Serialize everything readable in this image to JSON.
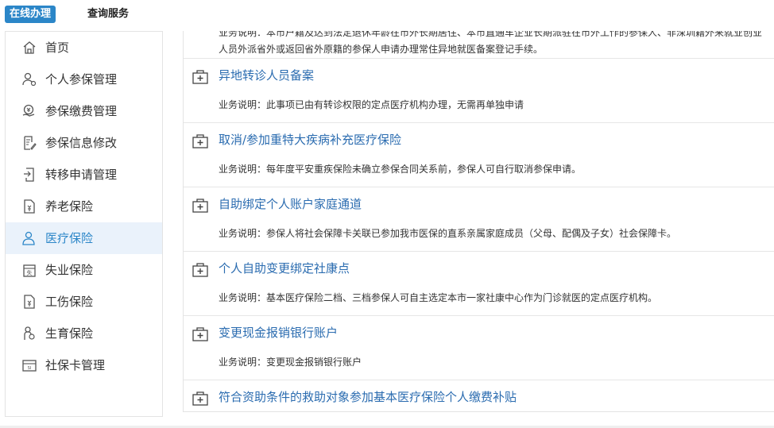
{
  "top_tabs": [
    {
      "label": "在线办理",
      "active": true
    },
    {
      "label": "查询服务",
      "active": false
    }
  ],
  "sidebar": {
    "items": [
      {
        "label": "首页",
        "icon": "home-icon"
      },
      {
        "label": "个人参保管理",
        "icon": "person-settings-icon"
      },
      {
        "label": "参保缴费管理",
        "icon": "payment-icon"
      },
      {
        "label": "参保信息修改",
        "icon": "edit-document-icon"
      },
      {
        "label": "转移申请管理",
        "icon": "transfer-icon"
      },
      {
        "label": "养老保险",
        "icon": "pension-doc-icon"
      },
      {
        "label": "医疗保险",
        "icon": "medical-person-icon",
        "active": true
      },
      {
        "label": "失业保险",
        "icon": "unemployment-icon"
      },
      {
        "label": "工伤保险",
        "icon": "injury-doc-icon"
      },
      {
        "label": "生育保险",
        "icon": "maternity-icon"
      },
      {
        "label": "社保卡管理",
        "icon": "card-icon"
      }
    ]
  },
  "main": {
    "top_description": "业务说明：本市户籍及达到法定退休年龄在市外长期居住、本市直通车企业长期派驻在市外工作的参保人、非深圳籍外来就业创业人员外派省外或返回省外原籍的参保人申请办理常住异地就医备案登记手续。",
    "services": [
      {
        "title": "异地转诊人员备案",
        "desc": "业务说明：此事项已由有转诊权限的定点医疗机构办理，无需再单独申请"
      },
      {
        "title": "取消/参加重特大疾病补充医疗保险",
        "desc": "业务说明：每年度平安重疾保险未确立参保合同关系前，参保人可自行取消参保申请。"
      },
      {
        "title": "自助绑定个人账户家庭通道",
        "desc": "业务说明：参保人将社会保障卡关联已参加我市医保的直系亲属家庭成员（父母、配偶及子女）社会保障卡。"
      },
      {
        "title": "个人自助变更绑定社康点",
        "desc": "业务说明：基本医疗保险二档、三档参保人可自主选定本市一家社康中心作为门诊就医的定点医疗机构。"
      },
      {
        "title": "变更现金报销银行账户",
        "desc": "业务说明：变更现金报销银行账户"
      },
      {
        "title": "符合资助条件的救助对象参加基本医疗保险个人缴费补贴",
        "desc": ""
      }
    ]
  },
  "colors": {
    "accent": "#2b86c8",
    "link": "#2b6cb0",
    "active_bg": "#eaf2fb"
  }
}
